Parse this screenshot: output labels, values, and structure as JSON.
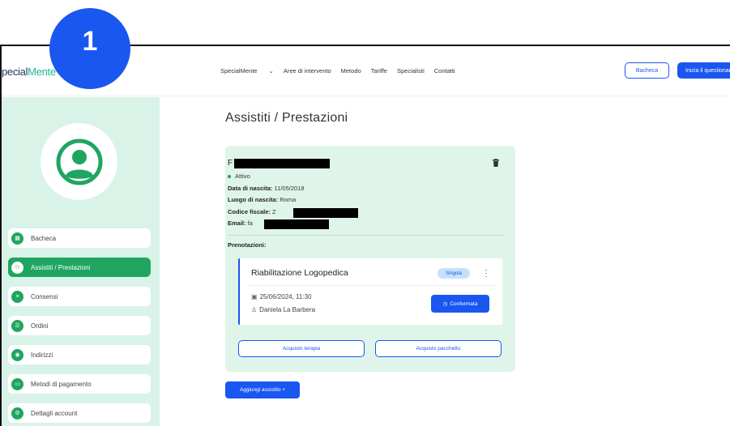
{
  "overlay": {
    "step_number": "1"
  },
  "header": {
    "logo_prefix": "pecial",
    "logo_suffix": "Mente",
    "nav": [
      {
        "label": "SpecialMente",
        "has_dropdown": true
      },
      {
        "label": "Aree di intervento"
      },
      {
        "label": "Metodo"
      },
      {
        "label": "Tariffe"
      },
      {
        "label": "Specialisti"
      },
      {
        "label": "Contatti"
      }
    ],
    "bacheca_button": "Bacheca",
    "cta_button": "Inizia il questionario"
  },
  "sidebar": {
    "items": [
      {
        "label": "Bacheca",
        "icon": "dashboard-icon",
        "active": false
      },
      {
        "label": "Assistiti / Prestazioni",
        "icon": "people-icon",
        "active": true
      },
      {
        "label": "Consensi",
        "icon": "document-icon",
        "active": false
      },
      {
        "label": "Ordini",
        "icon": "orders-icon",
        "active": false
      },
      {
        "label": "Indirizzi",
        "icon": "location-icon",
        "active": false
      },
      {
        "label": "Metodi di pagamento",
        "icon": "payment-icon",
        "active": false
      },
      {
        "label": "Dettagli account",
        "icon": "account-icon",
        "active": false
      }
    ]
  },
  "main": {
    "title": "Assistiti / Prestazioni",
    "patient": {
      "name_visible": "F",
      "status": "Attivo",
      "birth_date_label": "Data di nascita:",
      "birth_date": "11/05/2018",
      "birth_place_label": "Luogo di nascita:",
      "birth_place": "Roma",
      "fiscal_code_label": "Codice fiscale:",
      "fiscal_code_visible": "Z",
      "email_label": "Email:",
      "email_visible": "fa"
    },
    "bookings_label": "Prenotazioni:",
    "booking": {
      "title": "Riabilitazione Logopedica",
      "type_badge": "Singola",
      "datetime": "25/06/2024, 11:30",
      "specialist": "Daniela La Barbera",
      "status_button": "Confermata"
    },
    "buy_therapy_button": "Acquisto terapia",
    "buy_package_button": "Acquisto pacchetto",
    "add_patient_button": "Aggiungi assistito +"
  },
  "colors": {
    "accent_blue": "#1a56f0",
    "accent_green": "#1fa55f",
    "sidebar_bg": "#d9f3e9",
    "card_bg": "#dff5ea",
    "step_badge": "#1a56f0"
  }
}
